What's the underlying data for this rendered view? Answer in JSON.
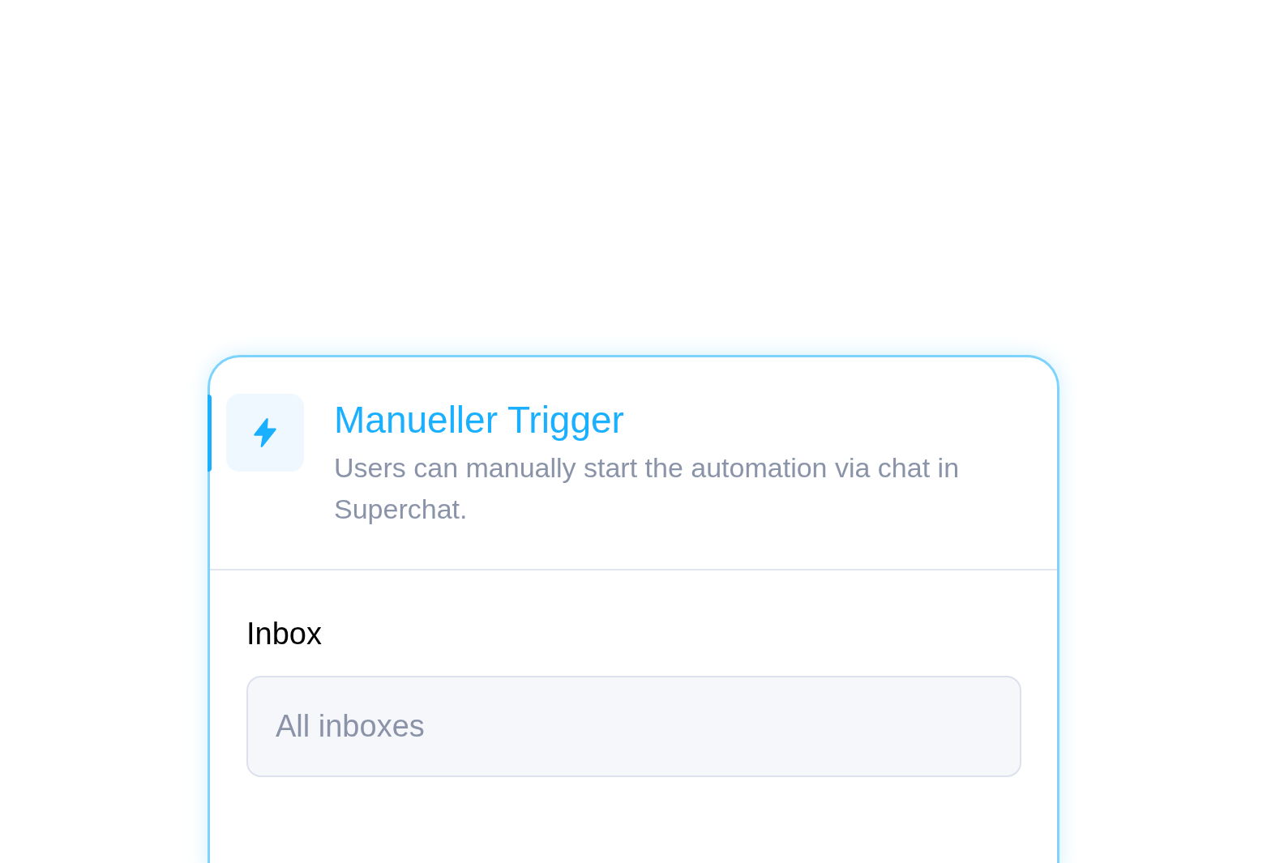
{
  "trigger": {
    "title": "Manueller Trigger",
    "description": "Users can manually start the automation via chat in Superchat.",
    "selected": true
  },
  "inbox_field": {
    "label": "Inbox",
    "placeholder": "All inboxes"
  }
}
